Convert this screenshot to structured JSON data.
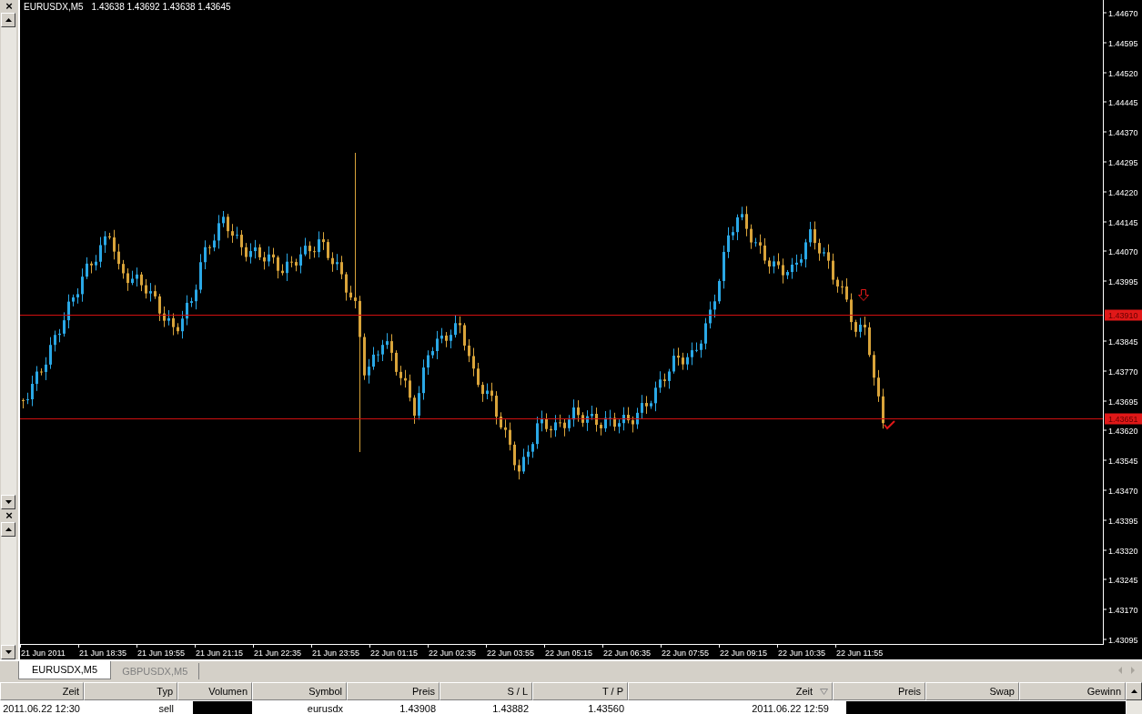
{
  "left_panel": {
    "close_buttons": [
      "×",
      "×"
    ]
  },
  "chart": {
    "symbol": "EURUSDX,M5",
    "quote": "1.43638 1.43692 1.43638 1.43645",
    "price_ticks": [
      "1.44670",
      "1.44595",
      "1.44520",
      "1.44445",
      "1.44370",
      "1.44295",
      "1.44220",
      "1.44145",
      "1.44070",
      "1.43995",
      "1.43845",
      "1.43770",
      "1.43695",
      "1.43620",
      "1.43545",
      "1.43470",
      "1.43395",
      "1.43320",
      "1.43245",
      "1.43170",
      "1.43095"
    ],
    "time_ticks": [
      "21 Jun 2011",
      "21 Jun 18:35",
      "21 Jun 19:55",
      "21 Jun 21:15",
      "21 Jun 22:35",
      "21 Jun 23:55",
      "22 Jun 01:15",
      "22 Jun 02:35",
      "22 Jun 03:55",
      "22 Jun 05:15",
      "22 Jun 06:35",
      "22 Jun 07:55",
      "22 Jun 09:15",
      "22 Jun 10:35",
      "22 Jun 11:55"
    ],
    "lines": [
      {
        "label": "1.43910"
      },
      {
        "label": "1.43651"
      }
    ]
  },
  "tabs": [
    {
      "label": "EURUSDX,M5",
      "selected": true
    },
    {
      "label": "GBPUSDX,M5",
      "selected": false
    }
  ],
  "table": {
    "columns": [
      {
        "label": "Zeit",
        "sorted": false
      },
      {
        "label": "Typ",
        "sorted": false
      },
      {
        "label": "Volumen",
        "sorted": false
      },
      {
        "label": "Symbol",
        "sorted": false
      },
      {
        "label": "Preis",
        "sorted": false
      },
      {
        "label": "S / L",
        "sorted": false
      },
      {
        "label": "T / P",
        "sorted": false
      },
      {
        "label": "Zeit",
        "sorted": true
      },
      {
        "label": "Preis",
        "sorted": false
      },
      {
        "label": "Swap",
        "sorted": false
      },
      {
        "label": "Gewinn",
        "sorted": false
      }
    ],
    "rows": [
      {
        "cells": [
          {
            "kind": "text",
            "text": "2011.06.22 12:30"
          },
          {
            "kind": "text",
            "text": "sell"
          },
          {
            "kind": "redacted"
          },
          {
            "kind": "text",
            "text": "eurusdx"
          },
          {
            "kind": "text",
            "text": "1.43908"
          },
          {
            "kind": "text",
            "text": "1.43882"
          },
          {
            "kind": "text",
            "text": "1.43560"
          },
          {
            "kind": "text",
            "text": "2011.06.22 12:59"
          },
          {
            "kind": "redacted"
          }
        ]
      }
    ]
  }
}
